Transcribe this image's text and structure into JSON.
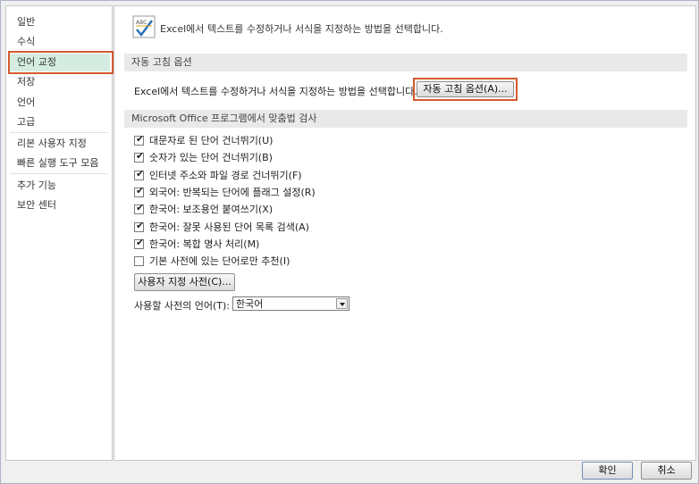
{
  "sidebar": {
    "items": [
      {
        "label": "일반"
      },
      {
        "label": "수식"
      },
      {
        "label": "언어 교정"
      },
      {
        "label": "저장"
      },
      {
        "label": "언어"
      },
      {
        "label": "고급"
      },
      {
        "label": "리본 사용자 지정"
      },
      {
        "label": "빠른 실행 도구 모음"
      },
      {
        "label": "추가 기능"
      },
      {
        "label": "보안 센터"
      }
    ],
    "active_index": 2
  },
  "main": {
    "header_text": "Excel에서 텍스트를 수정하거나 서식을 지정하는 방법을 선택합니다.",
    "header_icon": "abc-check-icon",
    "autocorrect_section": "자동 고침 옵션",
    "autocorrect_desc": "Excel에서 텍스트를 수정하거나 서식을 지정하는 방법을 선택합니다.",
    "autocorrect_button": "자동 고침 옵션(A)...",
    "spelling_section": "Microsoft Office 프로그램에서 맞춤법 검사",
    "checkboxes": [
      {
        "label": "대문자로 된 단어 건너뛰기(U)",
        "checked": true
      },
      {
        "label": "숫자가 있는 단어 건너뛰기(B)",
        "checked": true
      },
      {
        "label": "인터넷 주소와 파일 경로 건너뛰기(F)",
        "checked": true
      },
      {
        "label": "외국어: 반복되는 단어에 플래그 설정(R)",
        "checked": true
      },
      {
        "label": "한국어: 보조용언 붙여쓰기(X)",
        "checked": true
      },
      {
        "label": "한국어: 잘못 사용된 단어 목록 검색(A)",
        "checked": true
      },
      {
        "label": "한국어: 복합 명사 처리(M)",
        "checked": true
      },
      {
        "label": "기본 사전에 있는 단어로만 추천(I)",
        "checked": false
      }
    ],
    "custom_dict_button": "사용자 지정 사전(C)...",
    "dict_lang_label": "사용할 사전의 언어(T):",
    "dict_lang_value": "한국어"
  },
  "footer": {
    "ok_label": "확인",
    "cancel_label": "취소"
  },
  "colors": {
    "highlight": "#d45a2e",
    "active_bg": "#d5ede0"
  }
}
